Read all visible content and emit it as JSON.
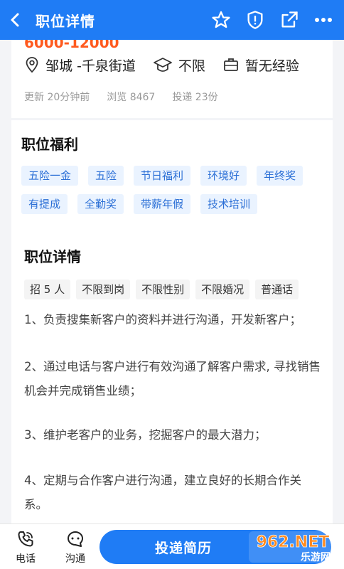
{
  "header": {
    "title": "职位详情",
    "icons": [
      "back-arrow-icon",
      "star-icon",
      "report-icon",
      "share-icon",
      "more-icon"
    ]
  },
  "job": {
    "salary_partial": "6000-12000",
    "location": "邹城 -千泉街道",
    "education": "不限",
    "experience": "暂无经验",
    "updated": "更新 20分钟前",
    "views": "浏览 8467",
    "applications": "投递 23份"
  },
  "benefits": {
    "title": "职位福利",
    "row1": [
      "五险一金",
      "五险",
      "节日福利",
      "环境好",
      "年终奖"
    ],
    "row2": [
      "有提成",
      "全勤奖",
      "带薪年假",
      "技术培训"
    ]
  },
  "details": {
    "title": "职位详情",
    "requirements": [
      "招 5 人",
      "不限到岗",
      "不限性别",
      "不限婚况",
      "普通话"
    ],
    "lines": [
      "1、负责搜集新客户的资料并进行沟通，开发新客户；",
      "2、通过电话与客户进行有效沟通了解客户需求, 寻找销售机会并完成销售业绩；",
      "3、维护老客户的业务，挖掘客户的最大潜力；",
      "4、定期与合作客户进行沟通，建立良好的长期合作关系。"
    ]
  },
  "bottom": {
    "phone_label": "电话",
    "chat_label": "沟通",
    "apply_label": "投递简历"
  },
  "watermark": {
    "text_top": "962.NET",
    "text_bottom": "乐游网"
  },
  "colors": {
    "brand_blue": "#1f7cf5",
    "salary_orange": "#ff5a1f",
    "tag_bg": "#eaf3ff",
    "tag_text": "#2b6fd6"
  }
}
